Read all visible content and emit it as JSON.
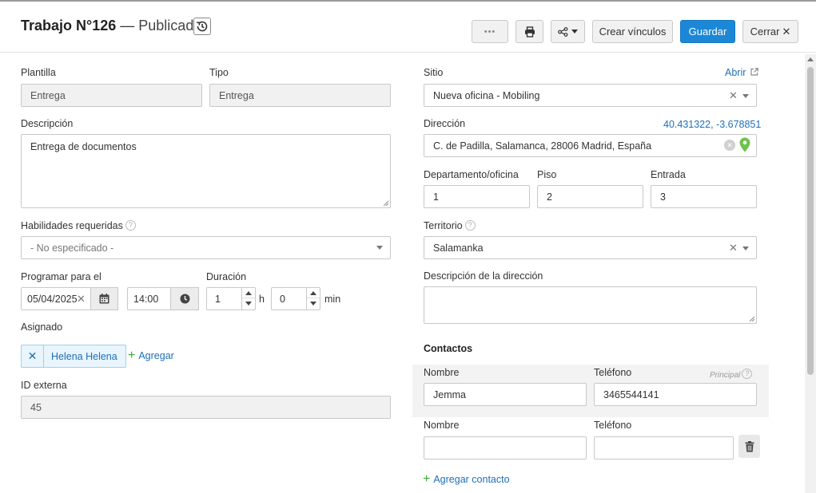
{
  "header": {
    "title": "Trabajo N°126",
    "dash": "—",
    "status": "Publicado",
    "buttons": {
      "more_label": "•••",
      "crear_vinculos": "Crear vínculos",
      "guardar": "Guardar",
      "cerrar": "Cerrar"
    }
  },
  "left": {
    "plantilla": {
      "label": "Plantilla",
      "value": "Entrega"
    },
    "tipo": {
      "label": "Tipo",
      "value": "Entrega"
    },
    "descripcion": {
      "label": "Descripción",
      "value": "Entrega de documentos"
    },
    "habilidades": {
      "label": "Habilidades requeridas",
      "value": "- No especificado -"
    },
    "programar": {
      "label": "Programar para el",
      "date": "05/04/2025",
      "time": "14:00"
    },
    "duracion": {
      "label": "Duración",
      "hours": "1",
      "hours_unit": "h",
      "minutes": "0",
      "minutes_unit": "min"
    },
    "asignado": {
      "label": "Asignado",
      "assignee": "Helena Helena",
      "add_label": "Agregar"
    },
    "id_externa": {
      "label": "ID externa",
      "value": "45"
    }
  },
  "right": {
    "sitio": {
      "label": "Sitio",
      "open_label": "Abrir",
      "value": "Nueva oficina - Mobiling"
    },
    "direccion": {
      "label": "Dirección",
      "coords": "40.431322, -3.678851",
      "value": "C. de Padilla, Salamanca, 28006 Madrid, España"
    },
    "departamento": {
      "label": "Departamento/oficina",
      "value": "1"
    },
    "piso": {
      "label": "Piso",
      "value": "2"
    },
    "entrada": {
      "label": "Entrada",
      "value": "3"
    },
    "territorio": {
      "label": "Territorio",
      "value": "Salamanka"
    },
    "desc_direccion": {
      "label": "Descripción de la dirección",
      "value": ""
    },
    "contactos": {
      "title": "Contactos",
      "principal_label": "Principal",
      "items": [
        {
          "nombre_label": "Nombre",
          "telefono_label": "Teléfono",
          "nombre": "Jemma",
          "telefono": "3465544141"
        },
        {
          "nombre_label": "Nombre",
          "telefono_label": "Teléfono",
          "nombre": "",
          "telefono": ""
        }
      ],
      "add_label": "Agregar contacto"
    }
  },
  "colors": {
    "primary": "#1c87d6",
    "link": "#1d6fb8",
    "add_green": "#3aaa35",
    "pin_green": "#6cc24a"
  },
  "icons": [
    "history-icon",
    "ellipsis-icon",
    "print-icon",
    "share-icon",
    "close-icon",
    "external-link-icon",
    "help-icon",
    "calendar-icon",
    "clock-icon",
    "map-pin-icon",
    "trash-icon",
    "plus-icon",
    "chevron-down-icon"
  ]
}
